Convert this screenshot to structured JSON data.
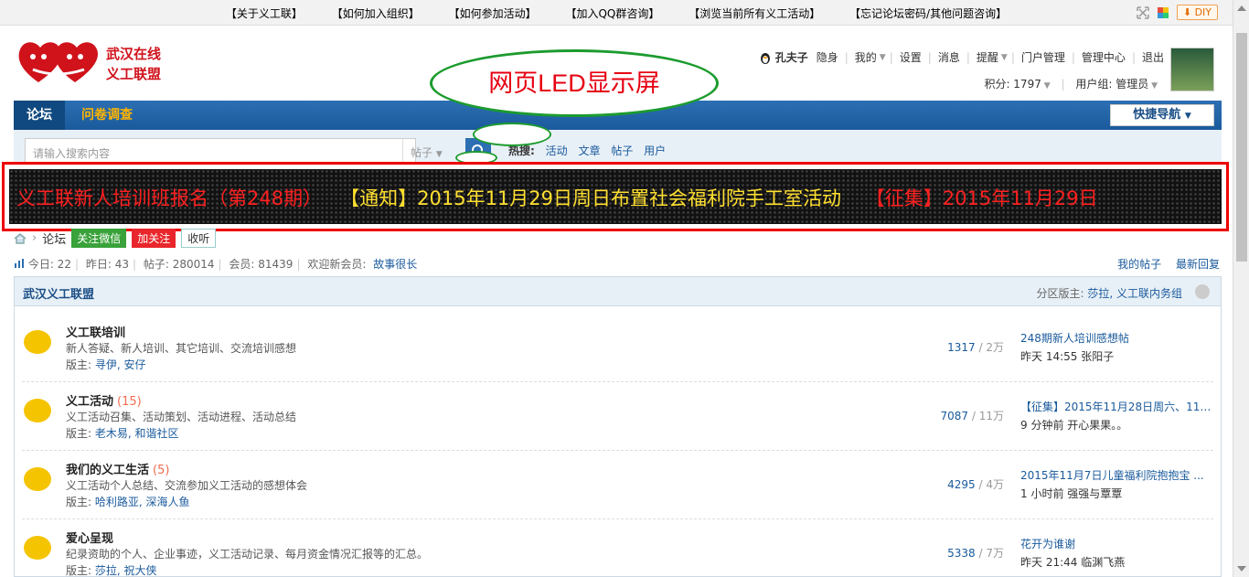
{
  "toplinks": [
    "【关于义工联】",
    "【如何加入组织】",
    "【如何参加活动】",
    "【加入QQ群咨询】",
    "【浏览当前所有义工活动】",
    "【忘记论坛密码/其他问题咨询】"
  ],
  "topright": {
    "diy_label": "DIY"
  },
  "logo": {
    "line1": "武汉在线",
    "line2": "义工联盟"
  },
  "user": {
    "name": "孔夫子",
    "items": [
      "隐身",
      "我的",
      "设置",
      "消息",
      "提醒",
      "门户管理",
      "管理中心",
      "退出"
    ],
    "credits": "积分: 1797",
    "group": "用户组: 管理员"
  },
  "bubble": {
    "text": "网页LED显示屏"
  },
  "nav": {
    "tabs": [
      "论坛",
      "问卷调查"
    ],
    "quick_nav": "快捷导航"
  },
  "search": {
    "placeholder": "请输入搜索内容",
    "type": "帖子",
    "hot_label": "热搜:",
    "hot_items": [
      "活动",
      "文章",
      "帖子",
      "用户"
    ]
  },
  "led": {
    "segments": [
      {
        "text": "义工联新人培训班报名（第248期）",
        "color": "red"
      },
      {
        "text": "【通知】2015年11月29日周日布置社会福利院手工室活动",
        "color": "yellow"
      },
      {
        "text": "【征集】2015年11月29日",
        "color": "red"
      }
    ]
  },
  "crumb": {
    "current": "论坛",
    "wechat": "关注微信",
    "weibo": "加关注",
    "listen": "收听"
  },
  "stats": {
    "today": "今日: 22",
    "yesterday": "昨日: 43",
    "posts": "帖子: 280014",
    "members": "会员: 81439",
    "welcome": "欢迎新会员:",
    "new_member": "故事很长",
    "my_posts": "我的帖子",
    "latest": "最新回复"
  },
  "section": {
    "title": "武汉义工联盟",
    "mods_label": "分区版主:",
    "mods": "莎拉, 义工联内务组"
  },
  "forums": [
    {
      "name": "义工联培训",
      "count": "",
      "desc": "新人答疑、新人培训、其它培训、交流培训感想",
      "mods": "寻伊, 安仔",
      "threads": "1317",
      "total": "2万",
      "last_title": "248期新人培训感想帖",
      "last_meta": "昨天 14:55 张阳子"
    },
    {
      "name": "义工活动",
      "count": "(15)",
      "desc": "义工活动召集、活动策划、活动进程、活动总结",
      "mods": "老木易, 和谐社区",
      "threads": "7087",
      "total": "11万",
      "last_title": "【征集】2015年11月28日周六、11 ...",
      "last_meta": "9 分钟前 开心果果。。"
    },
    {
      "name": "我们的义工生活",
      "count": "(5)",
      "desc": "义工活动个人总结、交流参加义工活动的感想体会",
      "mods": "哈利路亚, 深海人鱼",
      "threads": "4295",
      "total": "4万",
      "last_title": "2015年11月7日儿童福利院抱抱宝 ...",
      "last_meta": "1 小时前 强强与覃覃"
    },
    {
      "name": "爱心呈现",
      "count": "",
      "desc": "纪录资助的个人、企业事迹，义工活动记录、每月资金情况汇报等的汇总。",
      "mods": "莎拉, 祝大侠",
      "threads": "5338",
      "total": "7万",
      "last_title": "花开为谁谢",
      "last_meta": "昨天 21:44 临渊飞燕"
    }
  ],
  "labels": {
    "mods_prefix": "版主:",
    "slash": " / "
  },
  "colors": {
    "nav": "#1a5a9c",
    "led_red": "#ff2020",
    "led_yellow": "#ffe030",
    "bubble_border": "#1c9b2e"
  }
}
